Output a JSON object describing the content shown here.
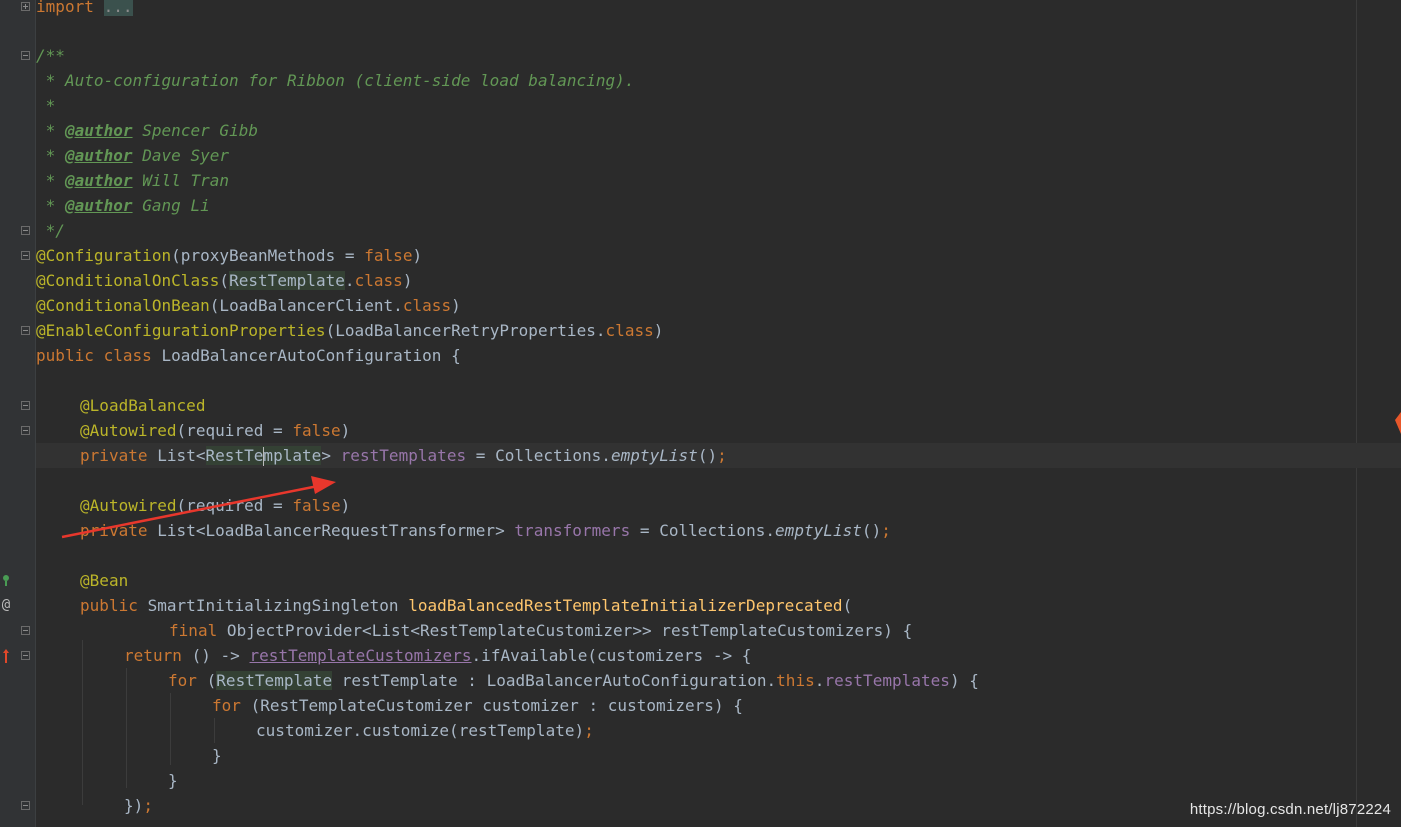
{
  "editor": {
    "lines": {
      "l1": {
        "kw": "import",
        "fold": "..."
      },
      "l3": "/**",
      "l4": " * Auto-configuration for Ribbon (client-side load balancing).",
      "l5": " *",
      "author_tag": "@author",
      "star_prefix": " * ",
      "authors": [
        "Spencer Gibb",
        "Dave Syer",
        "Will Tran",
        "Gang Li"
      ],
      "l10": " */",
      "l11": {
        "ann": "@Configuration",
        "open": "(proxyBeanMethods = ",
        "val": "false",
        "close": ")"
      },
      "l12": {
        "ann": "@ConditionalOnClass",
        "open": "(",
        "type": "RestTemplate",
        "dot": ".",
        "kw": "class",
        "close": ")"
      },
      "l13": {
        "ann": "@ConditionalOnBean",
        "open": "(LoadBalancerClient.",
        "kw": "class",
        "close": ")"
      },
      "l14": {
        "ann": "@EnableConfigurationProperties",
        "open": "(LoadBalancerRetryProperties.",
        "kw": "class",
        "close": ")"
      },
      "l15": {
        "kw": "public class",
        "rest": " LoadBalancerAutoConfiguration {"
      },
      "l17": {
        "ann": "@LoadBalanced"
      },
      "l18": {
        "ann": "@Autowired",
        "open": "(required = ",
        "val": "false",
        "close": ")"
      },
      "l19": {
        "kw": "private",
        "type_a": " List<",
        "type_b_pre": "RestTe",
        "type_b_post": "mplate",
        "type_c": "> ",
        "field": "restTemplates",
        "eq": " = Collections.",
        "call": "emptyList",
        "end": "()",
        "semi": ";"
      },
      "l21": {
        "ann": "@Autowired",
        "open": "(required = ",
        "val": "false",
        "close": ")"
      },
      "l22": {
        "kw": "private",
        "type": " List<LoadBalancerRequestTransformer> ",
        "field": "transformers",
        "eq": " = Collections.",
        "call": "emptyList",
        "end": "()",
        "semi": ";"
      },
      "l24": {
        "ann": "@Bean"
      },
      "l25": {
        "kw": "public",
        "type": " SmartInitializingSingleton ",
        "method": "loadBalancedRestTemplateInitializerDeprecated",
        "open": "("
      },
      "l26": {
        "kw": "final",
        "rest": " ObjectProvider<List<RestTemplateCustomizer>> restTemplateCustomizers) {"
      },
      "l27": {
        "kw": "return",
        "pre": " () -> ",
        "field": "restTemplateCustomizers",
        "rest": ".ifAvailable(customizers -> {"
      },
      "l28": {
        "kw": "for",
        "open": " (",
        "type": "RestTemplate",
        "mid": " restTemplate : LoadBalancerAutoConfiguration.",
        "this": "this",
        "dot": ".",
        "field": "restTemplates",
        "close": ") {"
      },
      "l29": {
        "kw": "for",
        "rest": " (RestTemplateCustomizer customizer : customizers) {"
      },
      "l30": {
        "call": "customizer.customize(restTemplate)",
        "semi": ";"
      },
      "l31": "}",
      "l32": "}",
      "l33": {
        "text": "})",
        "semi": ";"
      }
    }
  },
  "colors": {
    "background": "#2b2b2b",
    "keyword": "#cc7832",
    "annotation": "#bbb529",
    "comment": "#629755",
    "field": "#9876aa",
    "method": "#ffc66d",
    "default_text": "#a9b7c6",
    "arrow": "#e8372c"
  },
  "gutter": {
    "icons": [
      "bean-run-icon",
      "annotation-at-icon",
      "override-up-arrow-icon"
    ],
    "at_glyph": "@"
  },
  "watermark": "https://blog.csdn.net/lj872224"
}
